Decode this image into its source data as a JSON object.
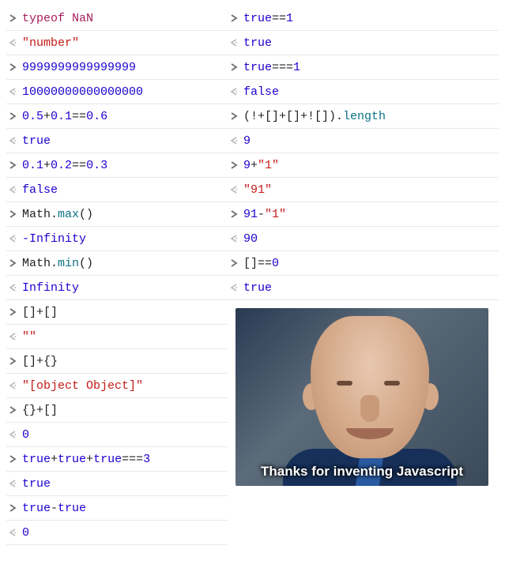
{
  "left": [
    {
      "kind": "in",
      "tokens": [
        [
          "kw",
          "typeof "
        ],
        [
          "kw",
          "NaN"
        ]
      ]
    },
    {
      "kind": "out",
      "tokens": [
        [
          "str",
          "\"number\""
        ]
      ]
    },
    {
      "kind": "in",
      "tokens": [
        [
          "num",
          "9999999999999999"
        ]
      ]
    },
    {
      "kind": "out",
      "tokens": [
        [
          "num",
          "10000000000000000"
        ]
      ]
    },
    {
      "kind": "in",
      "tokens": [
        [
          "num",
          "0.5"
        ],
        [
          "plain",
          "+"
        ],
        [
          "num",
          "0.1"
        ],
        [
          "plain",
          "=="
        ],
        [
          "num",
          "0.6"
        ]
      ]
    },
    {
      "kind": "out",
      "tokens": [
        [
          "num",
          "true"
        ]
      ]
    },
    {
      "kind": "in",
      "tokens": [
        [
          "num",
          "0.1"
        ],
        [
          "plain",
          "+"
        ],
        [
          "num",
          "0.2"
        ],
        [
          "plain",
          "=="
        ],
        [
          "num",
          "0.3"
        ]
      ]
    },
    {
      "kind": "out",
      "tokens": [
        [
          "num",
          "false"
        ]
      ]
    },
    {
      "kind": "in",
      "tokens": [
        [
          "plain",
          "Math."
        ],
        [
          "prop",
          "max"
        ],
        [
          "plain",
          "()"
        ]
      ]
    },
    {
      "kind": "out",
      "tokens": [
        [
          "num",
          "-Infinity"
        ]
      ]
    },
    {
      "kind": "in",
      "tokens": [
        [
          "plain",
          "Math."
        ],
        [
          "prop",
          "min"
        ],
        [
          "plain",
          "()"
        ]
      ]
    },
    {
      "kind": "out",
      "tokens": [
        [
          "num",
          "Infinity"
        ]
      ]
    },
    {
      "kind": "in",
      "tokens": [
        [
          "plain",
          "[]+[]"
        ]
      ]
    },
    {
      "kind": "out",
      "tokens": [
        [
          "str",
          "\"\""
        ]
      ]
    },
    {
      "kind": "in",
      "tokens": [
        [
          "plain",
          "[]+{}"
        ]
      ]
    },
    {
      "kind": "out",
      "tokens": [
        [
          "str",
          "\"[object Object]\""
        ]
      ]
    },
    {
      "kind": "in",
      "tokens": [
        [
          "plain",
          "{}+[]"
        ]
      ]
    },
    {
      "kind": "out",
      "tokens": [
        [
          "num",
          "0"
        ]
      ]
    },
    {
      "kind": "in",
      "tokens": [
        [
          "num",
          "true"
        ],
        [
          "plain",
          "+"
        ],
        [
          "num",
          "true"
        ],
        [
          "plain",
          "+"
        ],
        [
          "num",
          "true"
        ],
        [
          "plain",
          "==="
        ],
        [
          "num",
          "3"
        ]
      ]
    },
    {
      "kind": "out",
      "tokens": [
        [
          "num",
          "true"
        ]
      ]
    },
    {
      "kind": "in",
      "tokens": [
        [
          "num",
          "true"
        ],
        [
          "plain",
          "-"
        ],
        [
          "num",
          "true"
        ]
      ]
    },
    {
      "kind": "out",
      "tokens": [
        [
          "num",
          "0"
        ]
      ]
    }
  ],
  "right": [
    {
      "kind": "in",
      "tokens": [
        [
          "num",
          "true"
        ],
        [
          "plain",
          "=="
        ],
        [
          "num",
          "1"
        ]
      ]
    },
    {
      "kind": "out",
      "tokens": [
        [
          "num",
          "true"
        ]
      ]
    },
    {
      "kind": "in",
      "tokens": [
        [
          "num",
          "true"
        ],
        [
          "plain",
          "==="
        ],
        [
          "num",
          "1"
        ]
      ]
    },
    {
      "kind": "out",
      "tokens": [
        [
          "num",
          "false"
        ]
      ]
    },
    {
      "kind": "in",
      "tokens": [
        [
          "plain",
          "(!+[]+[]+![])."
        ],
        [
          "prop",
          "length"
        ]
      ]
    },
    {
      "kind": "out",
      "tokens": [
        [
          "num",
          "9"
        ]
      ]
    },
    {
      "kind": "in",
      "tokens": [
        [
          "num",
          "9"
        ],
        [
          "plain",
          "+"
        ],
        [
          "str",
          "\"1\""
        ]
      ]
    },
    {
      "kind": "out",
      "tokens": [
        [
          "str",
          "\"91\""
        ]
      ]
    },
    {
      "kind": "in",
      "tokens": [
        [
          "num",
          "91"
        ],
        [
          "plain",
          "-"
        ],
        [
          "str",
          "\"1\""
        ]
      ]
    },
    {
      "kind": "out",
      "tokens": [
        [
          "num",
          "90"
        ]
      ]
    },
    {
      "kind": "in",
      "tokens": [
        [
          "plain",
          "[]=="
        ],
        [
          "num",
          "0"
        ]
      ]
    },
    {
      "kind": "out",
      "tokens": [
        [
          "num",
          "true"
        ]
      ]
    }
  ],
  "caption": "Thanks for inventing Javascript",
  "colors": {
    "keyword": "#a71d5d",
    "number": "#1c00cf",
    "string": "#c41a16",
    "property": "#0b7285"
  }
}
